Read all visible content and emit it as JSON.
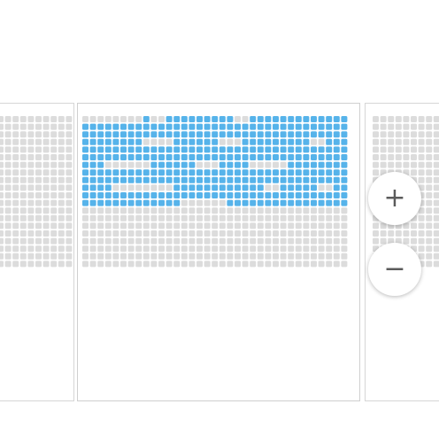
{
  "colors": {
    "empty": "#dcdcdc",
    "selected": "#56b3ea"
  },
  "icons": {
    "zoom_in": "plus-icon",
    "zoom_out": "minus-icon"
  },
  "zoom": {
    "in_label": "+",
    "out_label": "−"
  },
  "sections": {
    "left": {
      "rows": 20,
      "cols": 10
    },
    "right": {
      "rows": 20,
      "cols": 10
    },
    "center": {
      "rows": 20,
      "cols": 35,
      "selected_rows": [
        "00000000100111111111001111111111111",
        "11111111111111111111111111111111111",
        "11111111111111111111111111111111111",
        "11111111000011111100011111111100111",
        "11111111111111111111111111111111111",
        "11111111111111111111111111111111111",
        "11100000011111100011110000011111111",
        "11111111111111111111111111111111111",
        "11111111111111111111111111111111111",
        "11110000000011111111111100111110011",
        "11111111111111111111111111111111111",
        "11111111111110000001111111111111111",
        "00000000000000000000000000000000000",
        "00000000000000000000000000000000000",
        "00000000000000000000000000000000000",
        "00000000000000000000000000000000000",
        "00000000000000000000000000000000000",
        "00000000000000000000000000000000000",
        "00000000000000000000000000000000000",
        "00000000000000000000000000000000000"
      ]
    }
  }
}
